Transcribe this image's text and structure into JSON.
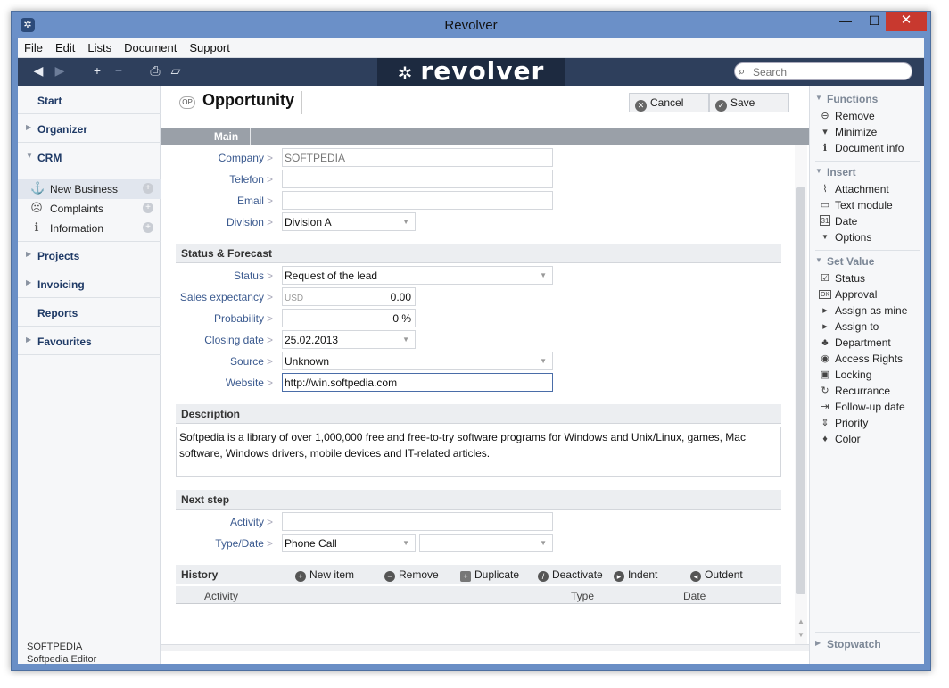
{
  "window": {
    "title": "Revolver",
    "logo": "revolver",
    "controls": {
      "minimize": "—",
      "maximize": "☐",
      "close": "✕"
    }
  },
  "menu": [
    "File",
    "Edit",
    "Lists",
    "Document",
    "Support"
  ],
  "search": {
    "placeholder": "Search"
  },
  "sidebar": {
    "items": [
      {
        "label": "Start"
      },
      {
        "label": "Organizer"
      },
      {
        "label": "CRM"
      },
      {
        "label": "Projects"
      },
      {
        "label": "Invoicing"
      },
      {
        "label": "Reports"
      },
      {
        "label": "Favourites"
      }
    ],
    "crm_sub": [
      {
        "label": "New Business",
        "icon": "anchor-icon",
        "glyph": "⚓"
      },
      {
        "label": "Complaints",
        "icon": "sad-face-icon",
        "glyph": "☹"
      },
      {
        "label": "Information",
        "icon": "info-icon",
        "glyph": "ℹ"
      }
    ],
    "user": {
      "company": "SOFTPEDIA",
      "name": "Softpedia Editor"
    }
  },
  "document": {
    "type_badge": "OP",
    "title": "Opportunity",
    "cancel_label": "Cancel",
    "save_label": "Save",
    "tab": "Main"
  },
  "fields": {
    "company": {
      "label": "Company",
      "value": "SOFTPEDIA"
    },
    "telefon": {
      "label": "Telefon",
      "value": ""
    },
    "email": {
      "label": "Email",
      "value": ""
    },
    "division": {
      "label": "Division",
      "value": "Division A"
    }
  },
  "status_forecast": {
    "heading": "Status & Forecast",
    "status": {
      "label": "Status",
      "value": "Request of the lead"
    },
    "sales_expectancy": {
      "label": "Sales expectancy",
      "currency": "USD",
      "value": "0.00"
    },
    "probability": {
      "label": "Probability",
      "value": "0 %"
    },
    "closing_date": {
      "label": "Closing date",
      "value": "25.02.2013"
    },
    "source": {
      "label": "Source",
      "value": "Unknown"
    },
    "website": {
      "label": "Website",
      "value": "http://win.softpedia.com"
    }
  },
  "description": {
    "heading": "Description",
    "text": "Softpedia is a library of over 1,000,000 free and free-to-try software programs for Windows and Unix/Linux, games, Mac software, Windows drivers, mobile devices and IT-related articles."
  },
  "next_step": {
    "heading": "Next step",
    "activity": {
      "label": "Activity",
      "value": ""
    },
    "type_date": {
      "label": "Type/Date",
      "type": "Phone Call",
      "date": ""
    }
  },
  "history": {
    "heading": "History",
    "actions": [
      "New item",
      "Remove",
      "Duplicate",
      "Deactivate",
      "Indent",
      "Outdent"
    ],
    "columns": [
      "Activity",
      "Type",
      "Date"
    ]
  },
  "rightbar": {
    "functions": {
      "heading": "Functions",
      "items": [
        "Remove",
        "Minimize",
        "Document info"
      ]
    },
    "insert": {
      "heading": "Insert",
      "items": [
        "Attachment",
        "Text module",
        "Date",
        "Options"
      ]
    },
    "set_value": {
      "heading": "Set Value",
      "items": [
        "Status",
        "Approval",
        "Assign as mine",
        "Assign to",
        "Department",
        "Access Rights",
        "Locking",
        "Recurrance",
        "Follow-up date",
        "Priority",
        "Color"
      ]
    },
    "stopwatch": {
      "heading": "Stopwatch"
    }
  }
}
